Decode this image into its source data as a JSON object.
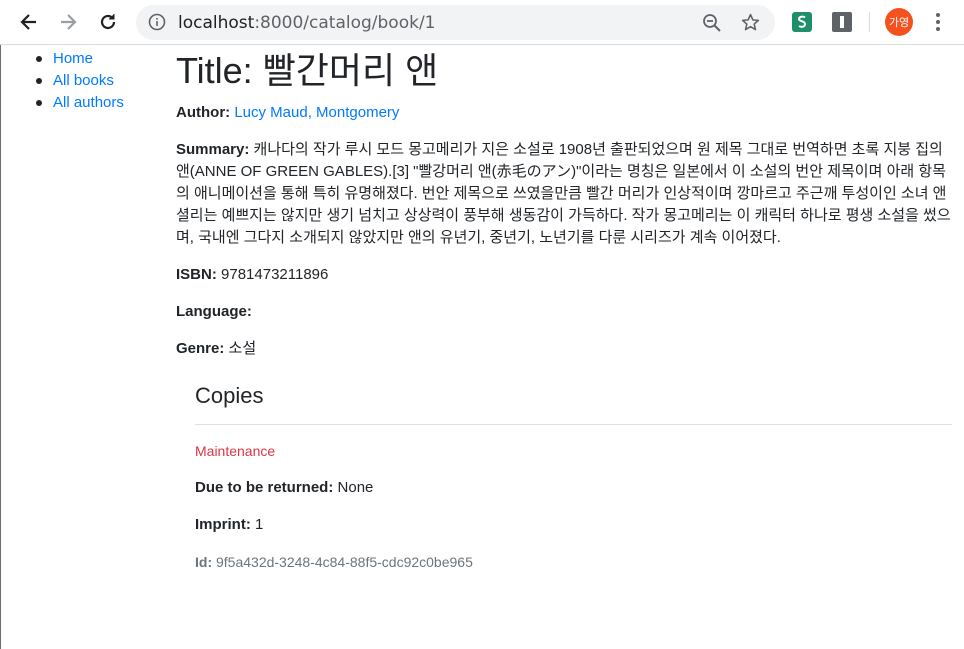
{
  "browser": {
    "url_host": "localhost",
    "url_path": ":8000/catalog/book/1",
    "profile_initials": "가영"
  },
  "sidebar": {
    "items": [
      {
        "label": "Home"
      },
      {
        "label": "All books"
      },
      {
        "label": "All authors"
      }
    ]
  },
  "book": {
    "title": "Title: 빨간머리 앤",
    "author_label": "Author:",
    "author_value": "Lucy Maud, Montgomery",
    "summary_label": "Summary:",
    "summary_value": "캐나다의 작가 루시 모드 몽고메리가 지은 소설로 1908년 출판되었으며 원 제목 그대로 번역하면 초록 지붕 집의 앤(ANNE OF GREEN GABLES).[3] \"빨강머리 앤(赤毛のアン)\"이라는 명칭은 일본에서 이 소설의 번안 제목이며 아래 항목의 애니메이션을 통해 특히 유명해졌다. 번안 제목으로 쓰였을만큼 빨간 머리가 인상적이며 깡마르고 주근깨 투성이인 소녀 앤 셜리는 예쁘지는 않지만 생기 넘치고 상상력이 풍부해 생동감이 가득하다. 작가 몽고메리는 이 캐릭터 하나로 평생 소설을 썼으며, 국내엔 그다지 소개되지 않았지만 앤의 유년기, 중년기, 노년기를 다룬 시리즈가 계속 이어졌다.",
    "isbn_label": "ISBN:",
    "isbn_value": "9781473211896",
    "language_label": "Language:",
    "language_value": "",
    "genre_label": "Genre:",
    "genre_value": "소설"
  },
  "copies": {
    "heading": "Copies",
    "items": [
      {
        "status": "Maintenance",
        "status_color": "#dc3545",
        "due_label": "Due to be returned:",
        "due_value": "None",
        "imprint_label": "Imprint:",
        "imprint_value": "1",
        "id_label": "Id:",
        "id_value": "9f5a432d-3248-4c84-88f5-cdc92c0be965"
      }
    ]
  },
  "colors": {
    "link": "#007bff",
    "text": "#212529",
    "muted": "#6c757d"
  }
}
